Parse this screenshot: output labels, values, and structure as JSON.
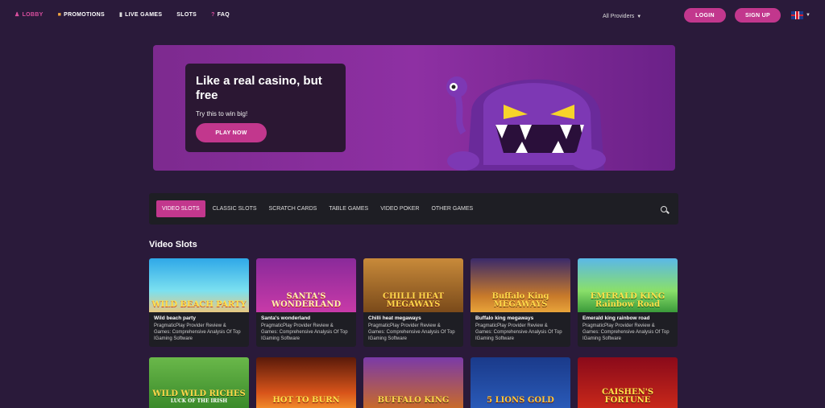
{
  "nav": {
    "links": [
      {
        "label": "LOBBY"
      },
      {
        "label": "PROMOTIONS"
      },
      {
        "label": "LIVE GAMES"
      },
      {
        "label": "SLOTS"
      },
      {
        "label": "FAQ"
      }
    ],
    "login": "LOGIN",
    "signup": "SIGN UP",
    "language_flag": "uk-flag-icon"
  },
  "hero": {
    "title": "Like a real casino, but free",
    "subtitle": "Try this to win big!",
    "cta": "PLAY NOW"
  },
  "categories": {
    "tabs": [
      "VIDEO SLOTS",
      "CLASSIC SLOTS",
      "SCRATCH CARDS",
      "TABLE GAMES",
      "VIDEO POKER",
      "OTHER GAMES"
    ],
    "active": "VIDEO SLOTS",
    "providers": "All Providers"
  },
  "section": {
    "title": "Video Slots"
  },
  "games_row1": [
    {
      "name": "Wild beach party",
      "desc": "PragmaticPlay Provider Review & Games: Comprehensive Analysis Of Top IGaming Software",
      "art": "WILD BEACH PARTY"
    },
    {
      "name": "Santa's wonderland",
      "desc": "PragmaticPlay Provider Review & Games: Comprehensive Analysis Of Top IGaming Software",
      "art": "SANTA'S WONDERLAND"
    },
    {
      "name": "Chilli heat megaways",
      "desc": "PragmaticPlay Provider Review & Games: Comprehensive Analysis Of Top IGaming Software",
      "art": "CHILLI HEAT MEGAWAYS"
    },
    {
      "name": "Buffalo king megaways",
      "desc": "PragmaticPlay Provider Review & Games: Comprehensive Analysis Of Top IGaming Software",
      "art": "Buffalo King MEGAWAYS"
    },
    {
      "name": "Emerald king rainbow road",
      "desc": "PragmaticPlay Provider Review & Games: Comprehensive Analysis Of Top IGaming Software",
      "art": "EMERALD KING Rainbow Road"
    }
  ],
  "games_row2": [
    {
      "art": "WILD WILD RICHES",
      "art_sub": "LUCK OF THE IRISH"
    },
    {
      "art": "HOT TO BURN"
    },
    {
      "art": "BUFFALO KING"
    },
    {
      "art": "5 LIONS GOLD"
    },
    {
      "art": "CAISHEN'S FORTUNE"
    }
  ]
}
